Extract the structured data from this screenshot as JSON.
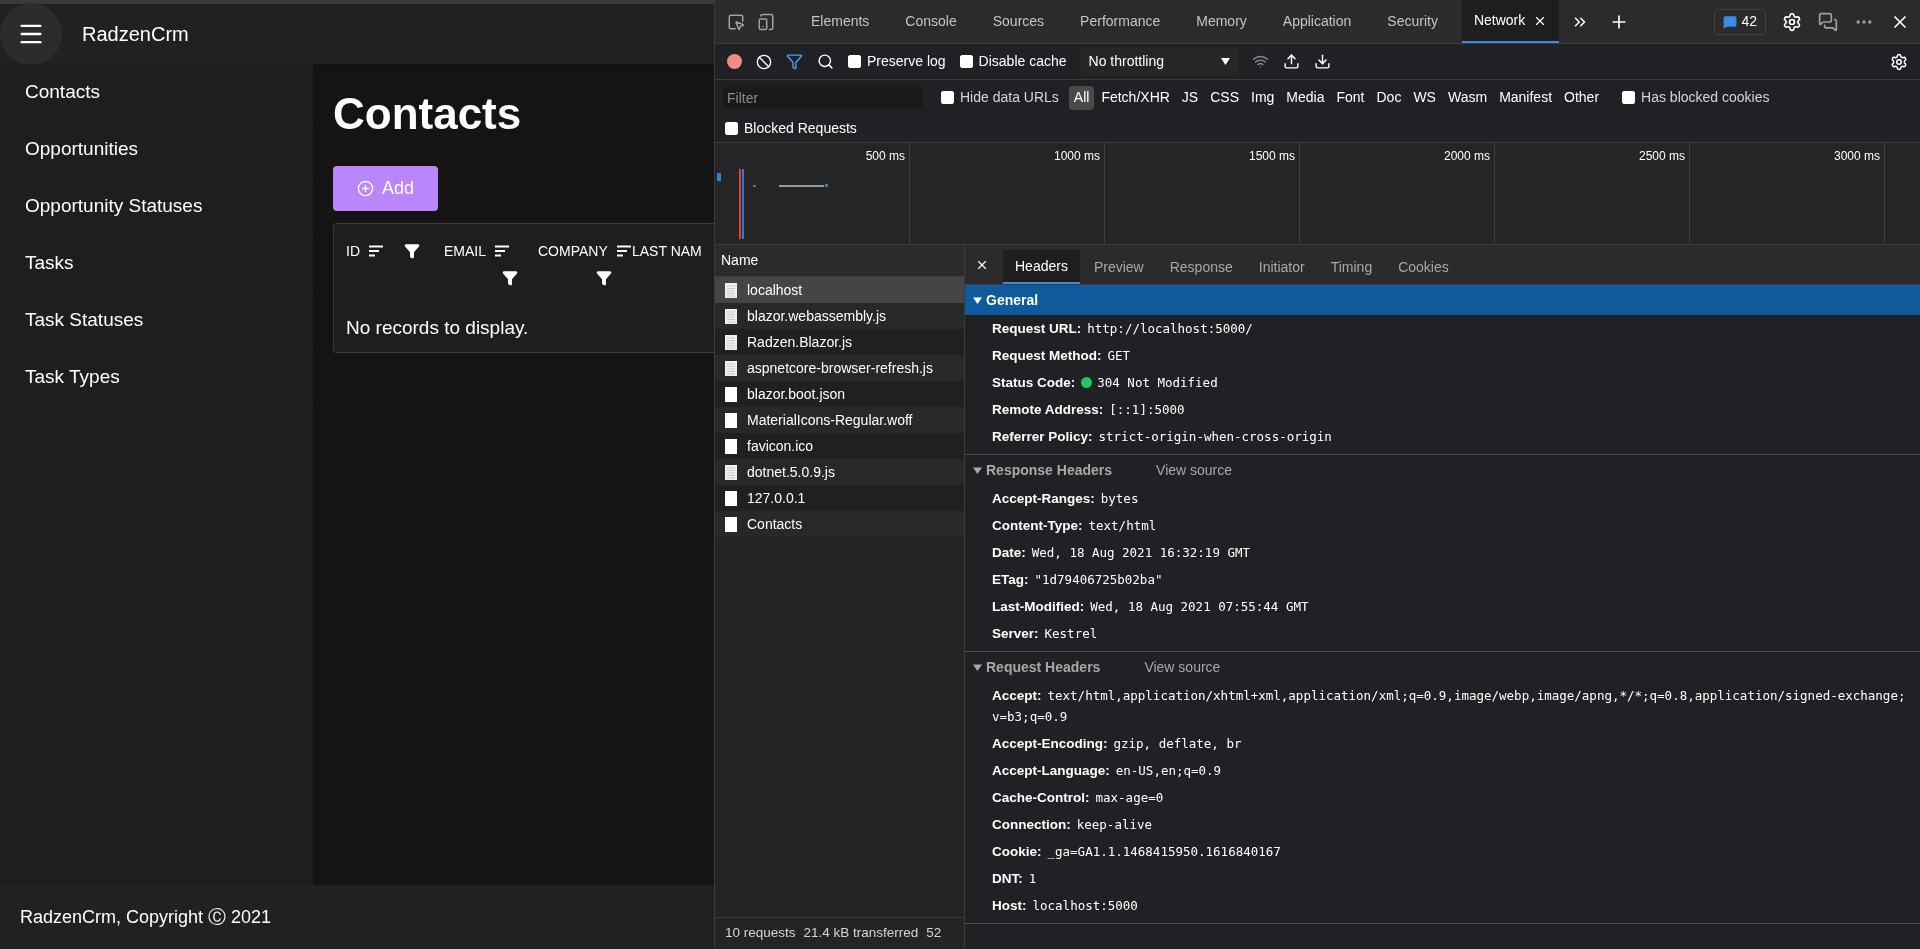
{
  "app": {
    "brand": "RadzenCrm",
    "nav": [
      {
        "label": "Contacts"
      },
      {
        "label": "Opportunities"
      },
      {
        "label": "Opportunity Statuses"
      },
      {
        "label": "Tasks"
      },
      {
        "label": "Task Statuses"
      },
      {
        "label": "Task Types"
      }
    ],
    "page_title": "Contacts",
    "add_button": "Add",
    "grid": {
      "columns": [
        {
          "label": "ID"
        },
        {
          "label": "EMAIL"
        },
        {
          "label": "COMPANY"
        },
        {
          "label": "LAST NAM"
        }
      ],
      "empty_message": "No records to display."
    },
    "footer": "RadzenCrm, Copyright Ⓒ 2021"
  },
  "devtools": {
    "tabs": [
      {
        "label": "Elements",
        "selected": false
      },
      {
        "label": "Console",
        "selected": false
      },
      {
        "label": "Sources",
        "selected": false
      },
      {
        "label": "Performance",
        "selected": false
      },
      {
        "label": "Memory",
        "selected": false
      },
      {
        "label": "Application",
        "selected": false
      },
      {
        "label": "Security",
        "selected": false
      },
      {
        "label": "Network",
        "selected": true
      }
    ],
    "issues_count": "42",
    "preserve_log": {
      "label": "Preserve log",
      "checked": false
    },
    "disable_cache": {
      "label": "Disable cache",
      "checked": false
    },
    "throttling": "No throttling",
    "filter": {
      "placeholder": "Filter"
    },
    "hide_data_urls": {
      "label": "Hide data URLs",
      "checked": false
    },
    "type_filters": [
      {
        "label": "All",
        "selected": true
      },
      {
        "label": "Fetch/XHR",
        "selected": false
      },
      {
        "label": "JS",
        "selected": false
      },
      {
        "label": "CSS",
        "selected": false
      },
      {
        "label": "Img",
        "selected": false
      },
      {
        "label": "Media",
        "selected": false
      },
      {
        "label": "Font",
        "selected": false
      },
      {
        "label": "Doc",
        "selected": false
      },
      {
        "label": "WS",
        "selected": false
      },
      {
        "label": "Wasm",
        "selected": false
      },
      {
        "label": "Manifest",
        "selected": false
      },
      {
        "label": "Other",
        "selected": false
      }
    ],
    "has_blocked_cookies": {
      "label": "Has blocked cookies",
      "checked": false
    },
    "blocked_requests": {
      "label": "Blocked Requests",
      "checked": false
    },
    "timeline_ticks": [
      "500 ms",
      "1000 ms",
      "1500 ms",
      "2000 ms",
      "2500 ms",
      "3000 ms"
    ],
    "requests": {
      "header": "Name",
      "items": [
        {
          "name": "localhost",
          "kind": "lined",
          "selected": true
        },
        {
          "name": "blazor.webassembly.js",
          "kind": "lined",
          "selected": false
        },
        {
          "name": "Radzen.Blazor.js",
          "kind": "lined",
          "selected": false
        },
        {
          "name": "aspnetcore-browser-refresh.js",
          "kind": "lined",
          "selected": false
        },
        {
          "name": "blazor.boot.json",
          "kind": "plain",
          "selected": false
        },
        {
          "name": "MaterialIcons-Regular.woff",
          "kind": "plain",
          "selected": false
        },
        {
          "name": "favicon.ico",
          "kind": "plain",
          "selected": false
        },
        {
          "name": "dotnet.5.0.9.js",
          "kind": "lined",
          "selected": false
        },
        {
          "name": "127.0.0.1",
          "kind": "plain",
          "selected": false
        },
        {
          "name": "Contacts",
          "kind": "plain",
          "selected": false
        }
      ]
    },
    "status": [
      "10 requests",
      "21.4 kB transferred",
      "52"
    ],
    "detail_tabs": [
      {
        "label": "Headers",
        "selected": true
      },
      {
        "label": "Preview",
        "selected": false
      },
      {
        "label": "Response",
        "selected": false
      },
      {
        "label": "Initiator",
        "selected": false
      },
      {
        "label": "Timing",
        "selected": false
      },
      {
        "label": "Cookies",
        "selected": false
      }
    ],
    "sections": [
      {
        "title": "General",
        "selected": true,
        "expanded": true,
        "headers": [
          {
            "name": "Request URL:",
            "value": "http://localhost:5000/",
            "kind": "text"
          },
          {
            "name": "Request Method:",
            "value": "GET",
            "kind": "text"
          },
          {
            "name": "Status Code:",
            "value": "304 Not Modified",
            "kind": "status"
          },
          {
            "name": "Remote Address:",
            "value": "[::1]:5000",
            "kind": "text"
          },
          {
            "name": "Referrer Policy:",
            "value": "strict-origin-when-cross-origin",
            "kind": "text"
          }
        ]
      },
      {
        "title": "Response Headers",
        "view_source": "View source",
        "selected": false,
        "expanded": true,
        "headers": [
          {
            "name": "Accept-Ranges:",
            "value": "bytes",
            "kind": "text"
          },
          {
            "name": "Content-Type:",
            "value": "text/html",
            "kind": "text"
          },
          {
            "name": "Date:",
            "value": "Wed, 18 Aug 2021 16:32:19 GMT",
            "kind": "text"
          },
          {
            "name": "ETag:",
            "value": "\"1d79406725b02ba\"",
            "kind": "text"
          },
          {
            "name": "Last-Modified:",
            "value": "Wed, 18 Aug 2021 07:55:44 GMT",
            "kind": "text"
          },
          {
            "name": "Server:",
            "value": "Kestrel",
            "kind": "text"
          }
        ]
      },
      {
        "title": "Request Headers",
        "view_source": "View source",
        "selected": false,
        "expanded": true,
        "headers": [
          {
            "name": "Accept:",
            "value": "text/html,application/xhtml+xml,application/xml;q=0.9,image/webp,image/apng,*/*;q=0.8,application/signed-exchange;v=b3;q=0.9",
            "kind": "text"
          },
          {
            "name": "Accept-Encoding:",
            "value": "gzip, deflate, br",
            "kind": "text"
          },
          {
            "name": "Accept-Language:",
            "value": "en-US,en;q=0.9",
            "kind": "text"
          },
          {
            "name": "Cache-Control:",
            "value": "max-age=0",
            "kind": "text"
          },
          {
            "name": "Connection:",
            "value": "keep-alive",
            "kind": "text"
          },
          {
            "name": "Cookie:",
            "value": "_ga=GA1.1.1468415950.1616840167",
            "kind": "text"
          },
          {
            "name": "DNT:",
            "value": "1",
            "kind": "text"
          },
          {
            "name": "Host:",
            "value": "localhost:5000",
            "kind": "text"
          }
        ]
      }
    ]
  }
}
